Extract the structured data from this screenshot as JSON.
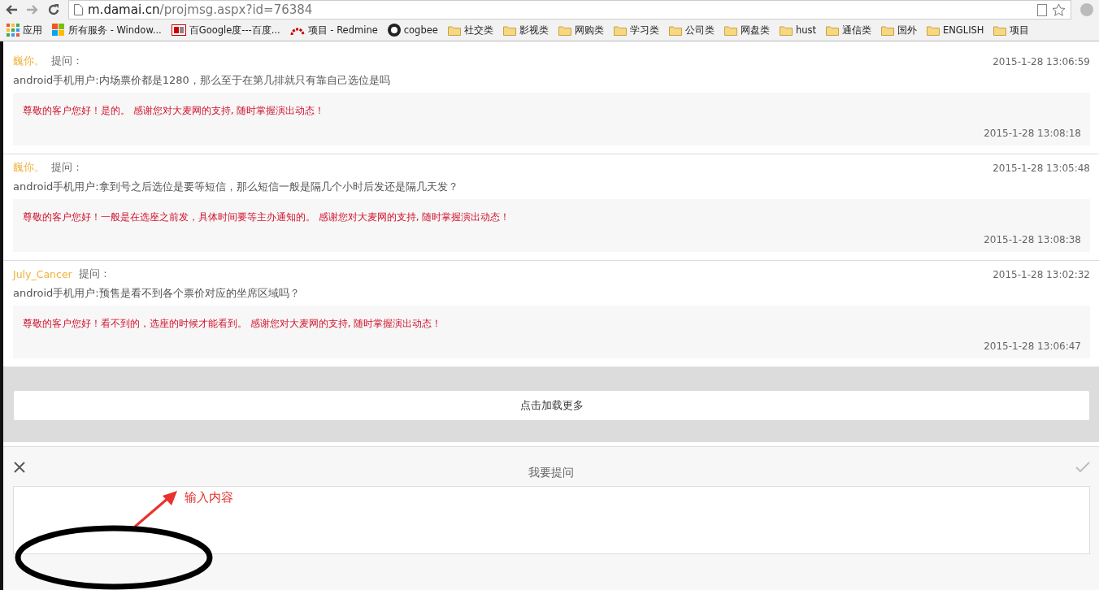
{
  "browser": {
    "url_host": "m.damai.cn",
    "url_path": "/projmsg.aspx?id=76384",
    "bookmarks": [
      {
        "kind": "apps",
        "label": "应用"
      },
      {
        "kind": "windows",
        "label": "所有服务 - Window..."
      },
      {
        "kind": "bc",
        "label": "百Google度---百度..."
      },
      {
        "kind": "redmine",
        "label": "项目 - Redmine"
      },
      {
        "kind": "github",
        "label": "cogbee"
      },
      {
        "kind": "folder",
        "label": "社交类"
      },
      {
        "kind": "folder",
        "label": "影视类"
      },
      {
        "kind": "folder",
        "label": "网购类"
      },
      {
        "kind": "folder",
        "label": "学习类"
      },
      {
        "kind": "folder",
        "label": "公司类"
      },
      {
        "kind": "folder",
        "label": "网盘类"
      },
      {
        "kind": "folder",
        "label": "hust"
      },
      {
        "kind": "folder",
        "label": "通信类"
      },
      {
        "kind": "folder",
        "label": "国外"
      },
      {
        "kind": "folder",
        "label": "ENGLISH"
      },
      {
        "kind": "folder",
        "label": "项目"
      }
    ]
  },
  "questions": [
    {
      "user": "巍你。",
      "ask_label": "提问：",
      "time": "2015-1-28 13:06:59",
      "text": "android手机用户:内场票价都是1280，那么至于在第几排就只有靠自己选位是吗",
      "reply": "尊敬的客户您好！是的。 感谢您对大麦网的支持, 随时掌握演出动态！",
      "reply_time": "2015-1-28 13:08:18"
    },
    {
      "user": "巍你。",
      "ask_label": "提问：",
      "time": "2015-1-28 13:05:48",
      "text": "android手机用户:拿到号之后选位是要等短信，那么短信一般是隔几个小时后发还是隔几天发？",
      "reply": "尊敬的客户您好！一般是在选座之前发，具体时间要等主办通知的。 感谢您对大麦网的支持, 随时掌握演出动态！",
      "reply_time": "2015-1-28 13:08:38"
    },
    {
      "user": "July_Cancer",
      "ask_label": "提问：",
      "time": "2015-1-28 13:02:32",
      "text": "android手机用户:预售是看不到各个票价对应的坐席区域吗？",
      "reply": "尊敬的客户您好！看不到的，选座的时候才能看到。 感谢您对大麦网的支持, 随时掌握演出动态！",
      "reply_time": "2015-1-28 13:06:47"
    }
  ],
  "load_more": "点击加载更多",
  "composer": {
    "title": "我要提问"
  },
  "annotation": {
    "label": "输入内容"
  }
}
